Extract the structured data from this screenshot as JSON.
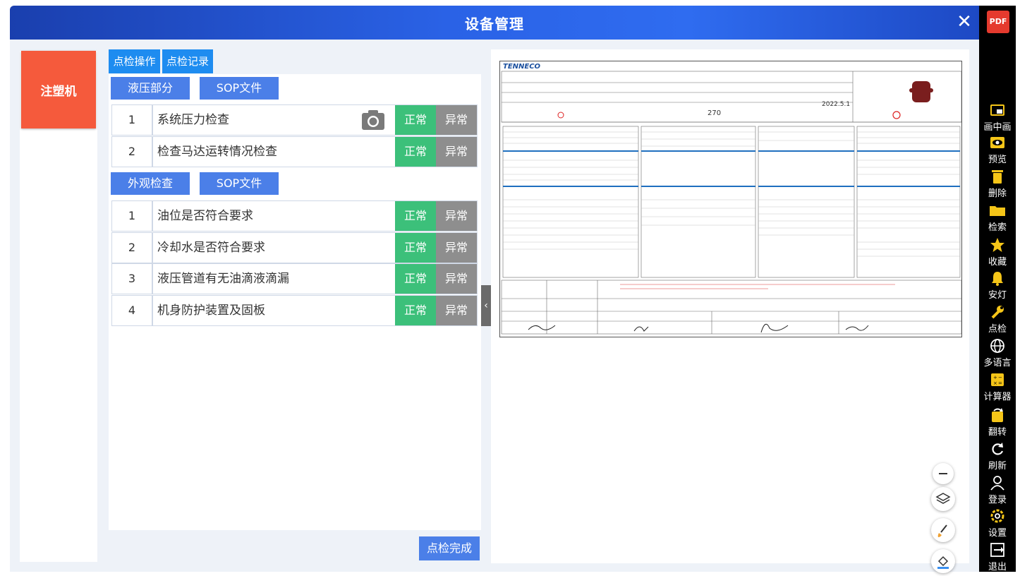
{
  "header": {
    "title": "设备管理",
    "close_label": "✕"
  },
  "machine": {
    "label": "注塑机"
  },
  "tabs": [
    {
      "label": "点检操作"
    },
    {
      "label": "点检记录"
    }
  ],
  "sections": [
    {
      "title": "液压部分",
      "sop_label": "SOP文件",
      "items": [
        {
          "no": "1",
          "text": "系统压力检查",
          "ok": "正常",
          "ng": "异常",
          "has_camera": true
        },
        {
          "no": "2",
          "text": "检查马达运转情况检查",
          "ok": "正常",
          "ng": "异常"
        }
      ]
    },
    {
      "title": "外观检查",
      "sop_label": "SOP文件",
      "items": [
        {
          "no": "1",
          "text": "油位是否符合要求",
          "ok": "正常",
          "ng": "异常"
        },
        {
          "no": "2",
          "text": "冷却水是否符合要求",
          "ok": "正常",
          "ng": "异常"
        },
        {
          "no": "3",
          "text": "液压管道有无油滴液滴漏",
          "ok": "正常",
          "ng": "异常"
        },
        {
          "no": "4",
          "text": "机身防护装置及固板",
          "ok": "正常",
          "ng": "异常"
        }
      ]
    }
  ],
  "done_label": "点检完成",
  "collapse_label": "‹",
  "document": {
    "logo": "TENNECO",
    "stamp_value": "270",
    "date_text": "2022.5.1"
  },
  "doc_tools": [
    {
      "name": "zoom-out-icon",
      "glyph": "−"
    },
    {
      "name": "layers-icon",
      "glyph": "≋"
    },
    {
      "name": "brush-icon",
      "glyph": "🖌"
    },
    {
      "name": "fill-icon",
      "glyph": "◈"
    }
  ],
  "sidebar": {
    "pdf_label": "PDF",
    "items": [
      {
        "label": "画中画",
        "icon": "pip-icon"
      },
      {
        "label": "预览",
        "icon": "eye-icon"
      },
      {
        "label": "删除",
        "icon": "trash-icon"
      },
      {
        "label": "检索",
        "icon": "folder-icon"
      },
      {
        "label": "收藏",
        "icon": "star-icon"
      },
      {
        "label": "安灯",
        "icon": "bell-icon"
      },
      {
        "label": "点检",
        "icon": "wrench-icon"
      },
      {
        "label": "多语言",
        "icon": "globe-icon"
      },
      {
        "label": "计算器",
        "icon": "calculator-icon"
      },
      {
        "label": "翻转",
        "icon": "rotate-icon"
      },
      {
        "label": "刷新",
        "icon": "refresh-icon"
      },
      {
        "label": "登录",
        "icon": "user-icon"
      },
      {
        "label": "设置",
        "icon": "settings-icon"
      },
      {
        "label": "退出",
        "icon": "logout-icon"
      }
    ]
  }
}
